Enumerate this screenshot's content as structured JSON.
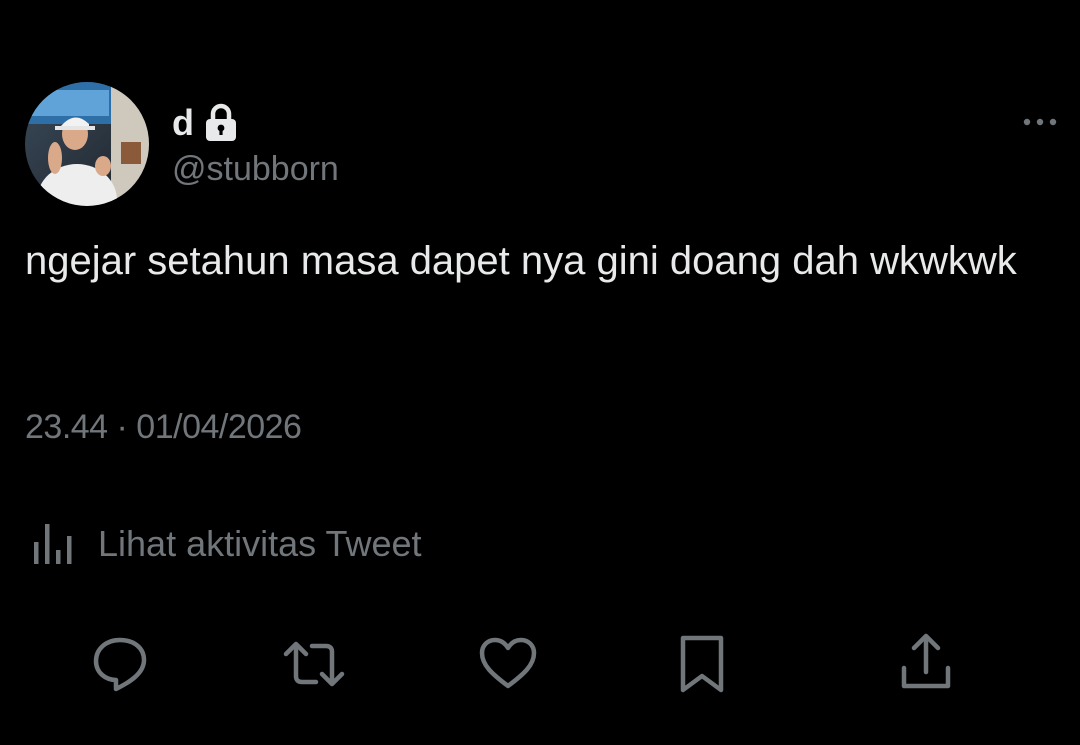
{
  "author": {
    "display_name": "d",
    "handle": "@stubborn",
    "protected": true
  },
  "tweet": {
    "text": "ngejar setahun masa dapet nya gini doang dah wkwkwk",
    "timestamp": "23.44 · 01/04/2026"
  },
  "activity": {
    "label": "Lihat aktivitas Tweet",
    "icon": "analytics-icon"
  },
  "actions": [
    {
      "name": "reply",
      "icon": "reply-icon"
    },
    {
      "name": "retweet",
      "icon": "retweet-icon"
    },
    {
      "name": "like",
      "icon": "heart-icon"
    },
    {
      "name": "bookmark",
      "icon": "bookmark-icon"
    },
    {
      "name": "share",
      "icon": "share-icon"
    }
  ],
  "colors": {
    "background": "#000000",
    "primary_text": "#e7e9ea",
    "secondary_text": "#71767b"
  }
}
